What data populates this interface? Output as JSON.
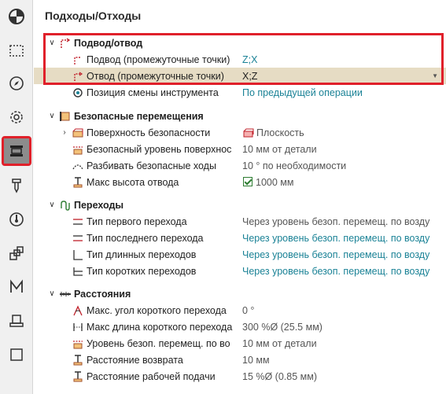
{
  "title": "Подходы/Отходы",
  "toolbar": [
    {
      "name": "toolbar-view-icon",
      "active": false
    },
    {
      "name": "toolbar-selection-icon",
      "active": false
    },
    {
      "name": "toolbar-compass-icon",
      "active": false
    },
    {
      "name": "toolbar-settings-icon",
      "active": false
    },
    {
      "name": "toolbar-leads-links-icon",
      "active": true
    },
    {
      "name": "toolbar-tool-icon",
      "active": false
    },
    {
      "name": "toolbar-feed-icon",
      "active": false
    },
    {
      "name": "toolbar-blocks-icon",
      "active": false
    },
    {
      "name": "toolbar-macro-icon",
      "active": false
    },
    {
      "name": "toolbar-stock-icon",
      "active": false
    },
    {
      "name": "toolbar-blank-icon",
      "active": false
    }
  ],
  "sections": {
    "approach": {
      "label": "Подвод/отвод",
      "rows": [
        {
          "label": "Подвод (промежуточные точки)",
          "value": "Z;X"
        },
        {
          "label": "Отвод (промежуточные точки)",
          "value": "X;Z"
        },
        {
          "label": "Позиция смены инструмента",
          "value": "По предыдущей операции"
        }
      ]
    },
    "safe": {
      "label": "Безопасные перемещения",
      "rows": [
        {
          "label": "Поверхность безопасности",
          "value": "Плоскость"
        },
        {
          "label": "Безопасный уровень поверхнос",
          "value": "10 мм от детали"
        },
        {
          "label": "Разбивать безопасные ходы",
          "value": "10 ° по необходимости"
        },
        {
          "label": "Макс высота отвода",
          "value": "1000 мм"
        }
      ]
    },
    "links": {
      "label": "Переходы",
      "rows": [
        {
          "label": "Тип первого перехода",
          "value": "Через уровень безоп. перемещ. по возду"
        },
        {
          "label": "Тип последнего перехода",
          "value": "Через уровень безоп. перемещ. по возду"
        },
        {
          "label": "Тип длинных переходов",
          "value": "Через уровень безоп. перемещ. по возду"
        },
        {
          "label": "Тип коротких переходов",
          "value": "Через уровень безоп. перемещ. по возду"
        }
      ]
    },
    "distances": {
      "label": "Расстояния",
      "rows": [
        {
          "label": "Макс. угол короткого перехода",
          "value": "0 °"
        },
        {
          "label": "Макс длина короткого перехода",
          "value": "300 %Ø (25.5 мм)"
        },
        {
          "label": "Уровень безоп. перемещ. по во",
          "value": "10 мм от детали"
        },
        {
          "label": "Расстояние возврата",
          "value": "10 мм"
        },
        {
          "label": "Расстояние рабочей подачи",
          "value": "15 %Ø (0.85 мм)"
        }
      ]
    }
  },
  "colors": {
    "accent_red": "#e0202a",
    "link_teal": "#1a8296",
    "selected_row": "#e6dcc4"
  }
}
